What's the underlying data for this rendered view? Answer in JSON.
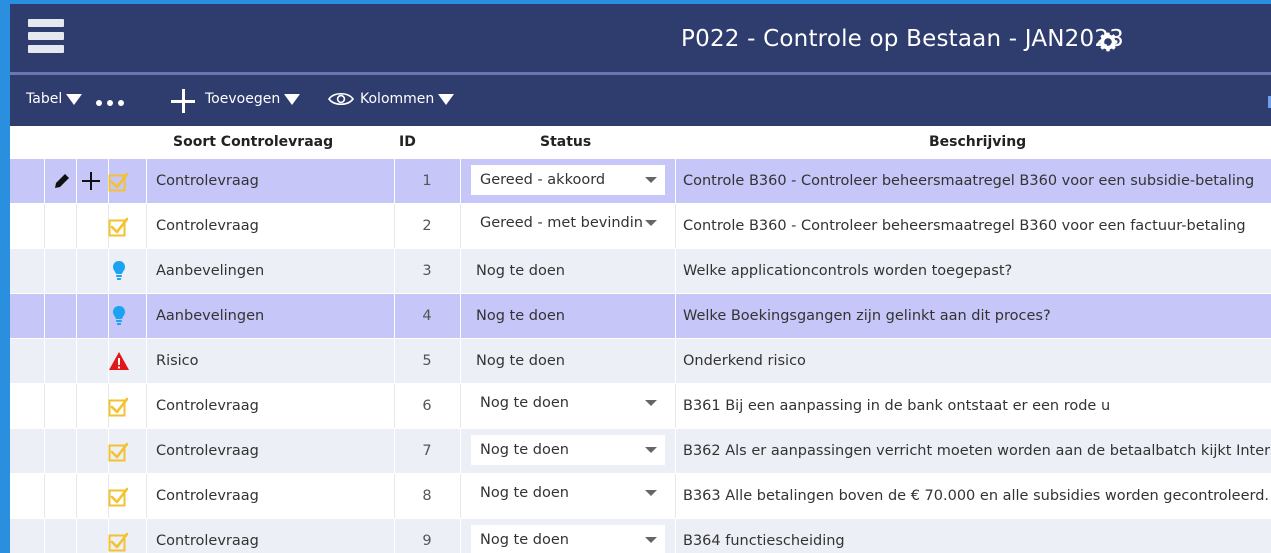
{
  "header": {
    "title": "P022 - Controle op Bestaan - JAN2023",
    "menu_icon": "hamburger-icon",
    "settings_icon": "gear-icon"
  },
  "toolbar": {
    "view_label": "Tabel",
    "add_label": "Toevoegen",
    "columns_label": "Kolommen"
  },
  "table": {
    "columns": [
      "Soort Controlevraag",
      "ID",
      "Status",
      "Beschrijving"
    ],
    "rows": [
      {
        "icon": "checkbox-icon",
        "soort": "Controlevraag",
        "id": "1",
        "status": "Gereed - akkoord",
        "status_dropdown": true,
        "beschrijving": "Controle B360 - Controleer beheersmaatregel B360 voor een subsidie-betaling",
        "selected": true,
        "actions": true
      },
      {
        "icon": "checkbox-icon",
        "soort": "Controlevraag",
        "id": "2",
        "status": "Gereed - met bevindin",
        "status_dropdown": true,
        "beschrijving": "Controle B360 - Controleer beheersmaatregel B360 voor een factuur-betaling",
        "selected": false
      },
      {
        "icon": "lightbulb-icon",
        "soort": "Aanbevelingen",
        "id": "3",
        "status": "Nog te doen",
        "status_dropdown": false,
        "beschrijving": "Welke applicationcontrols worden toegepast?",
        "selected": false
      },
      {
        "icon": "lightbulb-icon",
        "soort": "Aanbevelingen",
        "id": "4",
        "status": "Nog te doen",
        "status_dropdown": false,
        "beschrijving": "Welke Boekingsgangen zijn gelinkt aan dit proces?",
        "selected": true
      },
      {
        "icon": "warning-icon",
        "soort": "Risico",
        "id": "5",
        "status": "Nog te doen",
        "status_dropdown": false,
        "beschrijving": "Onderkend risico",
        "selected": false
      },
      {
        "icon": "checkbox-icon",
        "soort": "Controlevraag",
        "id": "6",
        "status": "Nog te doen",
        "status_dropdown": true,
        "beschrijving": "B361 Bij een aanpassing in de bank ontstaat er een rode u",
        "selected": false
      },
      {
        "icon": "checkbox-icon",
        "soort": "Controlevraag",
        "id": "7",
        "status": "Nog te doen",
        "status_dropdown": true,
        "beschrijving": "B362 Als er aanpassingen verricht moeten worden aan de betaalbatch kijkt Inter",
        "selected": false
      },
      {
        "icon": "checkbox-icon",
        "soort": "Controlevraag",
        "id": "8",
        "status": "Nog te doen",
        "status_dropdown": true,
        "beschrijving": "B363 Alle betalingen boven de € 70.000 en alle subsidies worden gecontroleerd.",
        "selected": false
      },
      {
        "icon": "checkbox-icon",
        "soort": "Controlevraag",
        "id": "9",
        "status": "Nog te doen",
        "status_dropdown": true,
        "beschrijving": "B364 functiescheiding",
        "selected": false
      }
    ]
  },
  "colors": {
    "header_bg": "#2f3c6e",
    "selected_row": "#c6c6f8",
    "alt_row": "#edeff6",
    "check_color": "#f2c230",
    "warning_color": "#e01818",
    "bulb_color": "#1aa3f0"
  }
}
